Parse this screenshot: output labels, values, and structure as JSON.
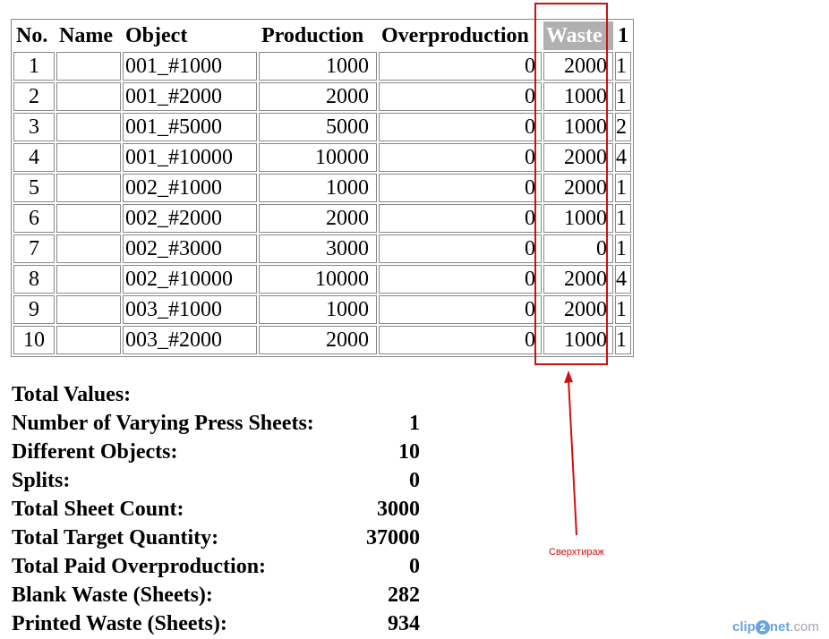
{
  "table": {
    "headers": [
      "No.",
      "Name",
      "Object",
      "Production",
      "Overproduction",
      "Waste",
      "1"
    ],
    "rows": [
      {
        "no": "1",
        "name": "",
        "object": "001_#1000",
        "production": "1000",
        "overproduction": "0",
        "waste": "2000",
        "last": "1"
      },
      {
        "no": "2",
        "name": "",
        "object": "001_#2000",
        "production": "2000",
        "overproduction": "0",
        "waste": "1000",
        "last": "1"
      },
      {
        "no": "3",
        "name": "",
        "object": "001_#5000",
        "production": "5000",
        "overproduction": "0",
        "waste": "1000",
        "last": "2"
      },
      {
        "no": "4",
        "name": "",
        "object": "001_#10000",
        "production": "10000",
        "overproduction": "0",
        "waste": "2000",
        "last": "4"
      },
      {
        "no": "5",
        "name": "",
        "object": "002_#1000",
        "production": "1000",
        "overproduction": "0",
        "waste": "2000",
        "last": "1"
      },
      {
        "no": "6",
        "name": "",
        "object": "002_#2000",
        "production": "2000",
        "overproduction": "0",
        "waste": "1000",
        "last": "1"
      },
      {
        "no": "7",
        "name": "",
        "object": "002_#3000",
        "production": "3000",
        "overproduction": "0",
        "waste": "0",
        "last": "1"
      },
      {
        "no": "8",
        "name": "",
        "object": "002_#10000",
        "production": "10000",
        "overproduction": "0",
        "waste": "2000",
        "last": "4"
      },
      {
        "no": "9",
        "name": "",
        "object": "003_#1000",
        "production": "1000",
        "overproduction": "0",
        "waste": "2000",
        "last": "1"
      },
      {
        "no": "10",
        "name": "",
        "object": "003_#2000",
        "production": "2000",
        "overproduction": "0",
        "waste": "1000",
        "last": "1"
      }
    ]
  },
  "totals": {
    "heading": "Total Values:",
    "items": [
      {
        "label": "Number of Varying Press Sheets:",
        "value": "1"
      },
      {
        "label": "Different Objects:",
        "value": "10"
      },
      {
        "label": "Splits:",
        "value": "0"
      },
      {
        "label": "Total Sheet Count:",
        "value": "3000"
      },
      {
        "label": "Total Target Quantity:",
        "value": "37000"
      },
      {
        "label": "Total Paid Overproduction:",
        "value": "0"
      },
      {
        "label": "Blank Waste (Sheets):",
        "value": "282"
      },
      {
        "label": "Printed Waste (Sheets):",
        "value": "934"
      }
    ]
  },
  "annotation": {
    "text": "Сверхтираж",
    "color": "#cc1111"
  },
  "watermark": {
    "part1": "clip",
    "part2": "2",
    "part3": "net",
    "part4": ".com"
  }
}
